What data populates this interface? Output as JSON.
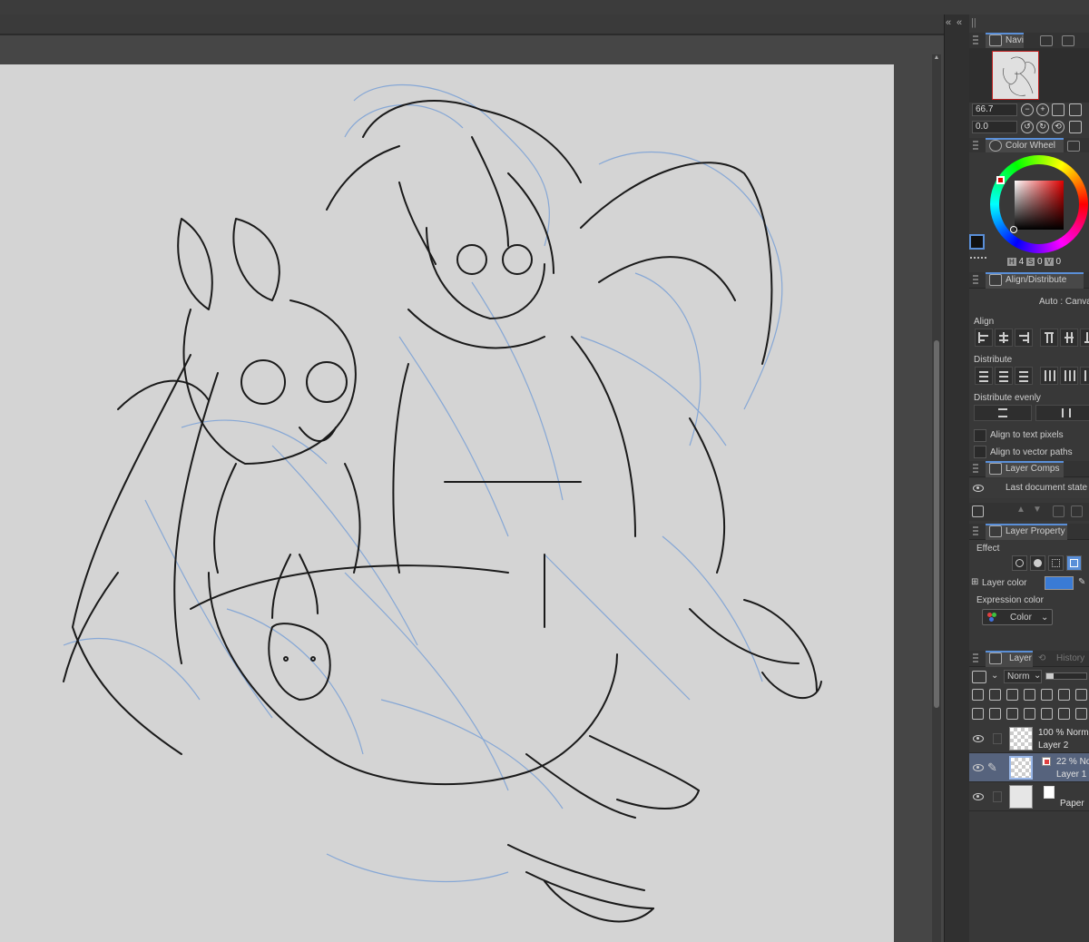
{
  "navigator": {
    "title": "Navi",
    "zoom": "66.7",
    "rotation": "0.0"
  },
  "color_wheel": {
    "title": "Color Wheel",
    "foreground_color": "#111111",
    "hue_color": "#e00000",
    "h_key": "H",
    "h_value": "4",
    "s_key": "S",
    "s_value": "0",
    "v_key": "V",
    "v_value": "0"
  },
  "align_distribute": {
    "title": "Align/Distribute",
    "mode": "Auto : Canva",
    "align_label": "Align",
    "distribute_label": "Distribute",
    "distribute_evenly_label": "Distribute evenly",
    "option_text_pixels": "Align to text pixels",
    "option_vector_paths": "Align to vector paths"
  },
  "layer_comps": {
    "title": "Layer Comps",
    "state": "Last document state"
  },
  "layer_property": {
    "title": "Layer Property",
    "effect_label": "Effect",
    "layer_color_label": "Layer color",
    "layer_color_value": "#3a7bd5",
    "expression_color_label": "Expression color",
    "expression_color_value": "Color"
  },
  "layer_panel": {
    "tab_layer": "Layer",
    "tab_history": "History",
    "blend_mode": "Norm",
    "layers": [
      {
        "line1": "100 % Norma",
        "line2": "Layer 2"
      },
      {
        "line1": "22 % No",
        "line2": "Layer 1"
      },
      {
        "line1": "",
        "line2": "Paper"
      }
    ]
  },
  "colors": {
    "accent": "#5a8fd8",
    "canvas_bg": "#d4d4d4",
    "sketch_blue": "#7ea3d6",
    "lineart": "#1a1a1a"
  }
}
